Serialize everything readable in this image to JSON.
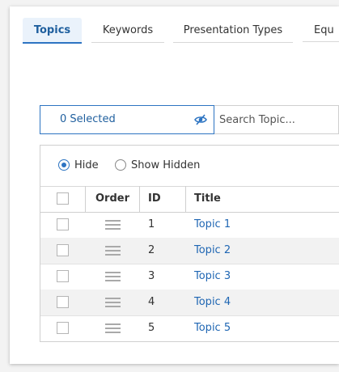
{
  "tabs": [
    {
      "label": "Topics",
      "active": true
    },
    {
      "label": "Keywords",
      "active": false
    },
    {
      "label": "Presentation Types",
      "active": false
    },
    {
      "label": "Equ",
      "active": false
    }
  ],
  "filter": {
    "selected_label": "0 Selected",
    "toggle_icon": "eye-slash-icon",
    "search_placeholder": "Search Topic..."
  },
  "visibility": {
    "hide_label": "Hide",
    "show_hidden_label": "Show Hidden",
    "selected": "hide"
  },
  "table": {
    "headers": {
      "order": "Order",
      "id": "ID",
      "title": "Title"
    },
    "rows": [
      {
        "id": "1",
        "title": "Topic 1"
      },
      {
        "id": "2",
        "title": "Topic 2"
      },
      {
        "id": "3",
        "title": "Topic 3"
      },
      {
        "id": "4",
        "title": "Topic 4"
      },
      {
        "id": "5",
        "title": "Topic 5"
      }
    ]
  },
  "colors": {
    "accent": "#2d74c2",
    "link": "#1f66b3",
    "tab_active_bg": "#eaf2fb"
  }
}
